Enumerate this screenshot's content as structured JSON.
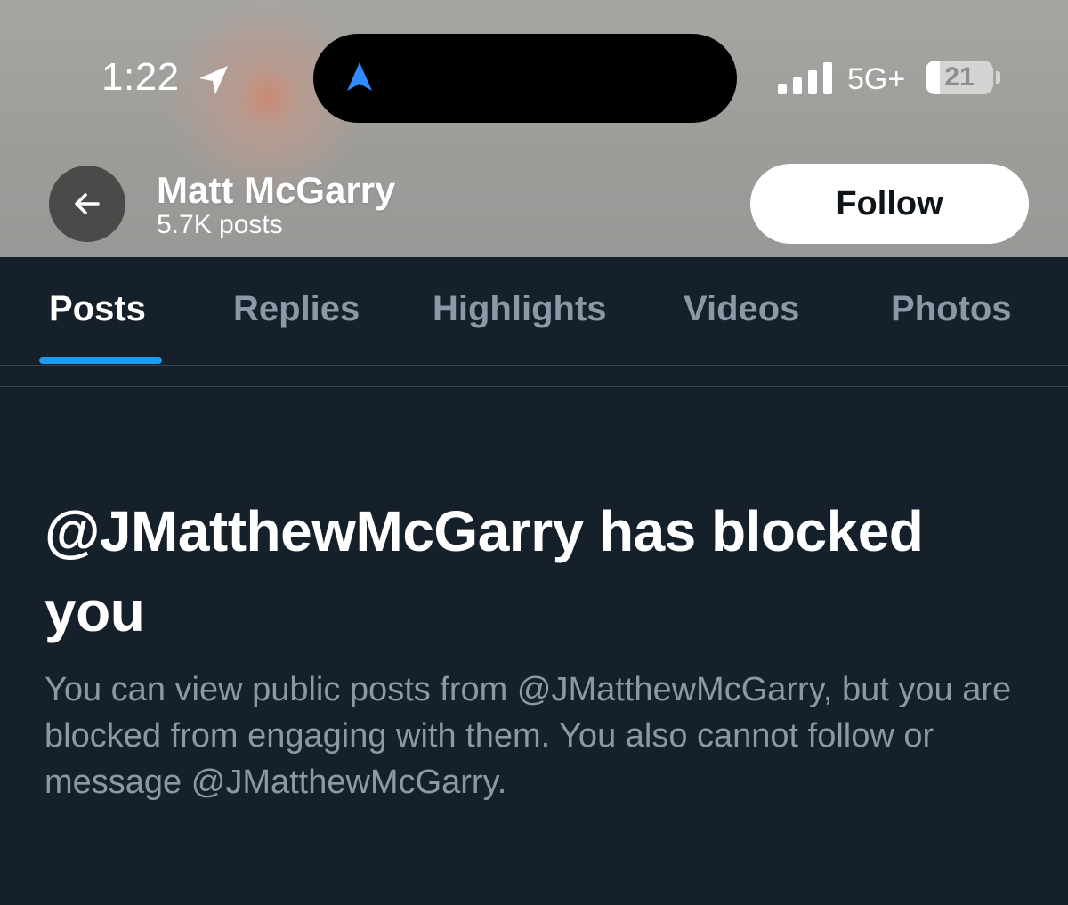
{
  "status_bar": {
    "time": "1:22",
    "location_icon": "location-arrow-icon",
    "island_icon": "navigation-arrow-icon",
    "signal_icon": "cellular-signal-icon",
    "network": "5G+",
    "battery": "21",
    "battery_level_percent": 21
  },
  "header": {
    "back_icon": "back-arrow-icon",
    "name": "Matt McGarry",
    "post_count": "5.7K posts",
    "follow_label": "Follow"
  },
  "tabs": [
    {
      "label": "Posts",
      "active": true
    },
    {
      "label": "Replies",
      "active": false
    },
    {
      "label": "Highlights",
      "active": false
    },
    {
      "label": "Videos",
      "active": false
    },
    {
      "label": "Photos",
      "active": false
    }
  ],
  "blocked": {
    "title": "@JMatthewMcGarry has blocked you",
    "body": "You can view public posts from @JMatthewMcGarry, but you are blocked from engaging with them. You also cannot follow or message @JMatthewMcGarry."
  },
  "colors": {
    "background": "#15202b",
    "accent": "#1d9bf0",
    "muted_text": "#8b98a5",
    "island_arrow": "#2f8cff"
  }
}
